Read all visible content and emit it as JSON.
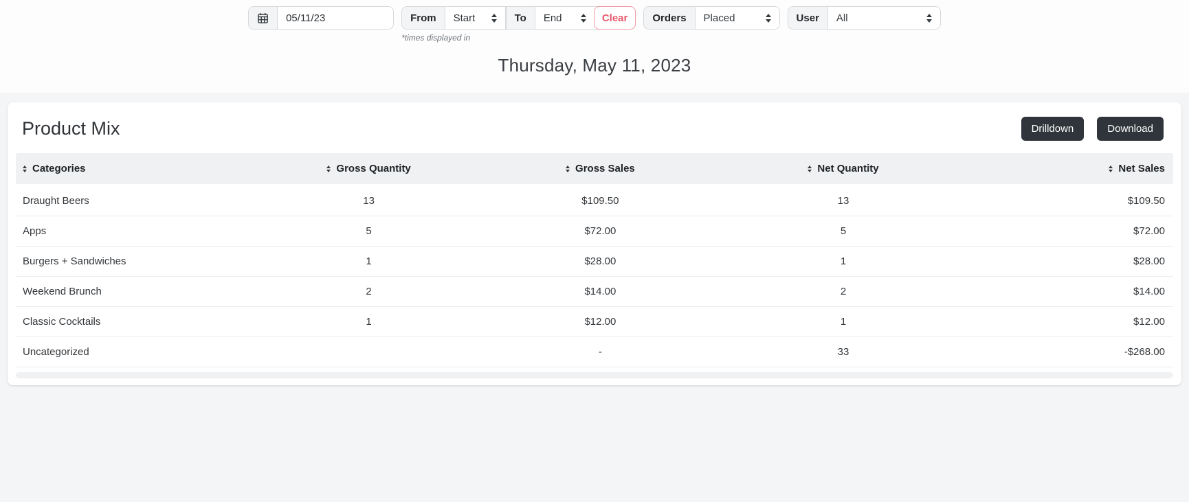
{
  "toolbar": {
    "date_value": "05/11/23",
    "from_label": "From",
    "start_value": "Start",
    "to_label": "To",
    "end_value": "End",
    "clear_label": "Clear",
    "orders_label": "Orders",
    "orders_value": "Placed",
    "user_label": "User",
    "user_value": "All",
    "times_note": "*times displayed in"
  },
  "page": {
    "date_heading": "Thursday, May 11, 2023"
  },
  "card": {
    "title": "Product Mix",
    "drilldown_label": "Drilldown",
    "download_label": "Download"
  },
  "table": {
    "columns": [
      {
        "label": "Categories"
      },
      {
        "label": "Gross Quantity"
      },
      {
        "label": "Gross Sales"
      },
      {
        "label": "Net Quantity"
      },
      {
        "label": "Net Sales"
      }
    ],
    "rows": [
      [
        "Draught Beers",
        "13",
        "$109.50",
        "13",
        "$109.50"
      ],
      [
        "Apps",
        "5",
        "$72.00",
        "5",
        "$72.00"
      ],
      [
        "Burgers + Sandwiches",
        "1",
        "$28.00",
        "1",
        "$28.00"
      ],
      [
        "Weekend Brunch",
        "2",
        "$14.00",
        "2",
        "$14.00"
      ],
      [
        "Classic Cocktails",
        "1",
        "$12.00",
        "1",
        "$12.00"
      ],
      [
        "Uncategorized",
        "",
        "-",
        "33",
        "-$268.00"
      ]
    ]
  },
  "colors": {
    "dark_button": "#2f353a",
    "clear_red": "#e8596b",
    "header_strip": "#eff1f2",
    "page_background": "#f4f5f6"
  }
}
